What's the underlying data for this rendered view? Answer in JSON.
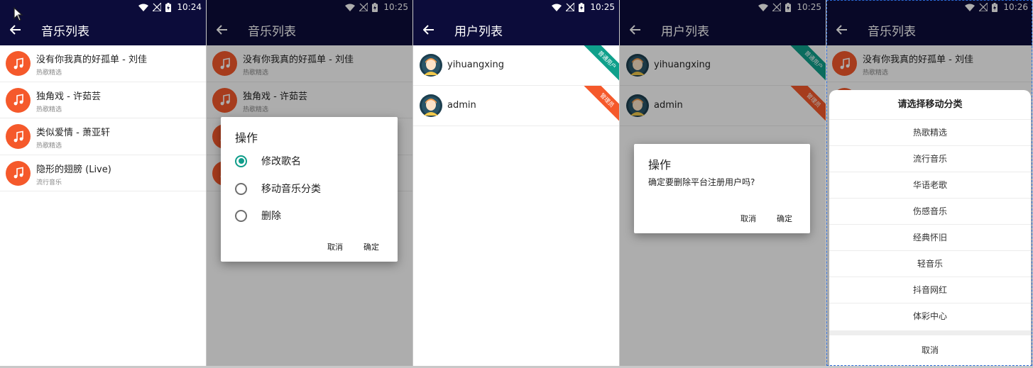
{
  "screens": [
    {
      "status_time": "10:24",
      "title": "音乐列表",
      "songs": [
        {
          "title": "没有你我真的好孤单 - 刘佳",
          "category": "热歌精选"
        },
        {
          "title": "独角戏 - 许茹芸",
          "category": "热歌精选"
        },
        {
          "title": "类似爱情 - 萧亚轩",
          "category": "热歌精选"
        },
        {
          "title": "隐形的翅膀 (Live)",
          "category": "流行音乐"
        }
      ]
    },
    {
      "status_time": "10:25",
      "title": "音乐列表",
      "songs": [
        {
          "title": "没有你我真的好孤单 - 刘佳",
          "category": "热歌精选"
        },
        {
          "title": "独角戏 - 许茹芸",
          "category": "热歌精选"
        }
      ],
      "dialog": {
        "title": "操作",
        "options": [
          {
            "label": "修改歌名",
            "checked": true
          },
          {
            "label": "移动音乐分类",
            "checked": false
          },
          {
            "label": "删除",
            "checked": false
          }
        ],
        "cancel": "取消",
        "confirm": "确定"
      }
    },
    {
      "status_time": "10:25",
      "title": "用户列表",
      "users": [
        {
          "name": "yihuangxing",
          "role": "普通用户",
          "role_color": "#0fa08b"
        },
        {
          "name": "admin",
          "role": "管理员",
          "role_color": "#f5592b"
        }
      ]
    },
    {
      "status_time": "10:25",
      "title": "用户列表",
      "users": [
        {
          "name": "yihuangxing",
          "role": "普通用户",
          "role_color": "#0fa08b"
        },
        {
          "name": "admin",
          "role": "管理员",
          "role_color": "#f5592b"
        }
      ],
      "dialog": {
        "title": "操作",
        "message": "确定要删除平台注册用户吗?",
        "cancel": "取消",
        "confirm": "确定"
      }
    },
    {
      "status_time": "10:26",
      "title": "音乐列表",
      "songs": [
        {
          "title": "没有你我真的好孤单 - 刘佳",
          "category": "热歌精选"
        }
      ],
      "sheet": {
        "title": "请选择移动分类",
        "items": [
          "热歌精选",
          "流行音乐",
          "华语老歌",
          "伤感音乐",
          "经典怀旧",
          "轻音乐",
          "抖音网红",
          "体彩中心"
        ],
        "cancel": "取消"
      }
    }
  ],
  "colors": {
    "appbar": "#0c0c3a",
    "accent": "#f5592b",
    "teal": "#0fa08b"
  }
}
